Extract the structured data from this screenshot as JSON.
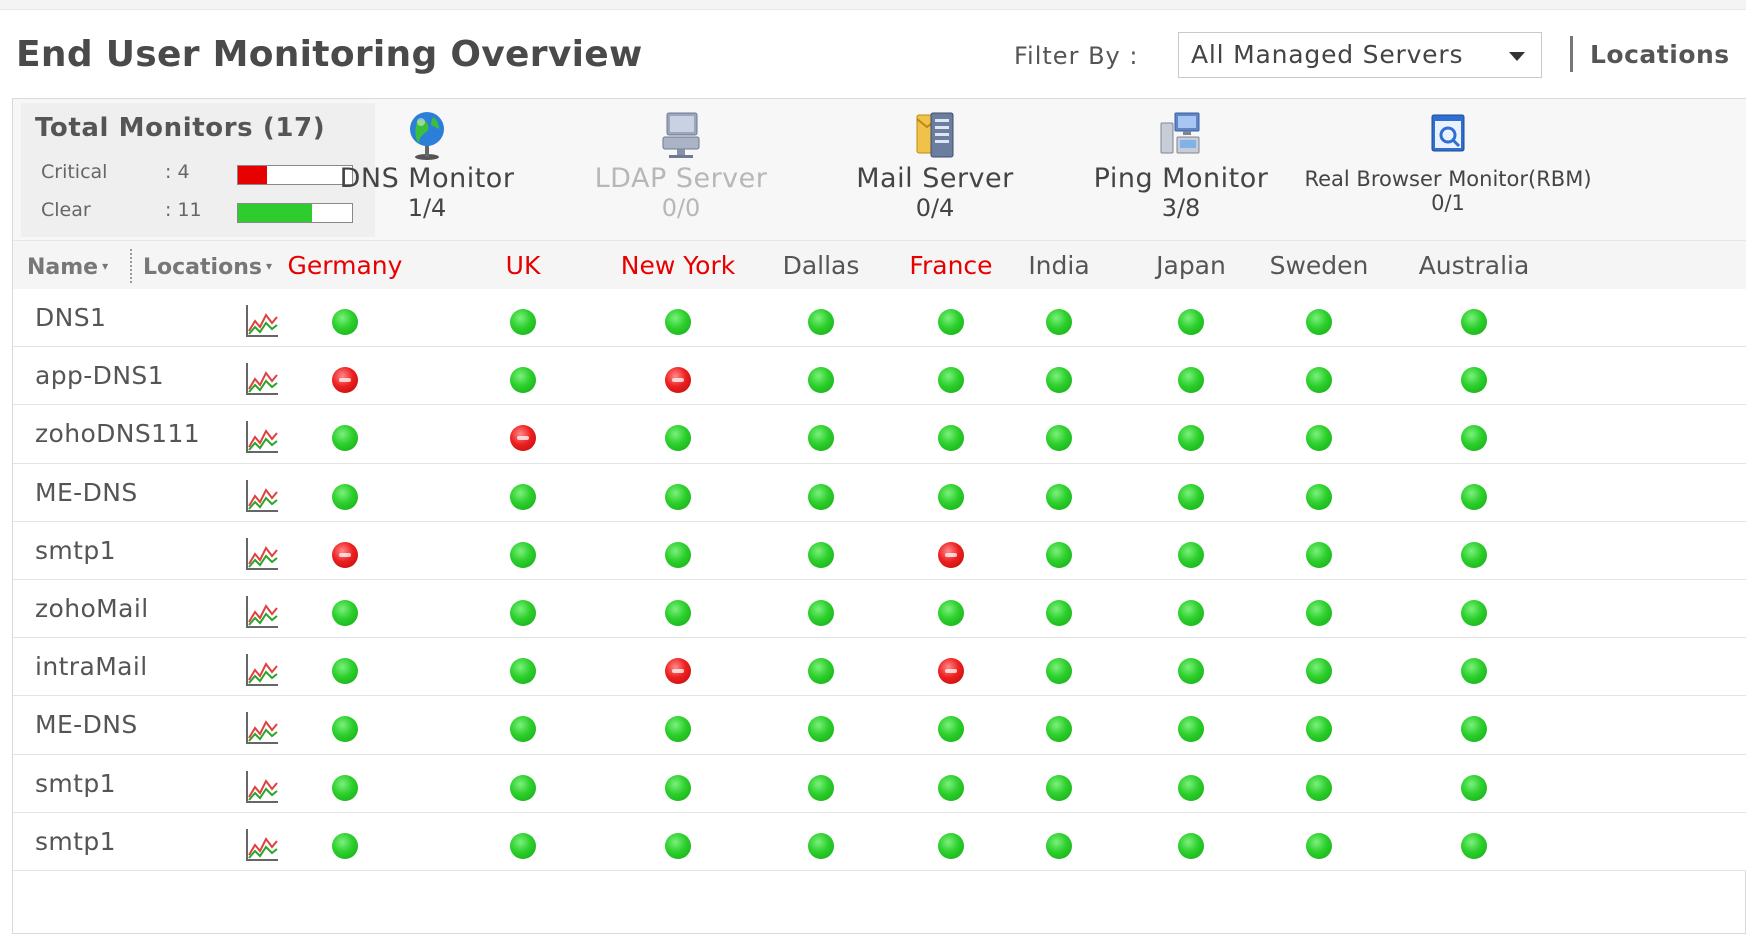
{
  "page": {
    "title": "End User Monitoring Overview",
    "filter_label": "Filter By :",
    "filter_value": "All Managed Servers",
    "locations_link": "Locations"
  },
  "summary": {
    "total_label": "Total Monitors (17)",
    "critical_label": "Critical",
    "critical_value": ": 4",
    "critical_fraction": 0.25,
    "clear_label": "Clear",
    "clear_value": ": 11",
    "clear_fraction": 0.65,
    "colors": {
      "critical": "#e60000",
      "clear": "#2ecc2e",
      "alert_text": "#e60000"
    }
  },
  "monitor_types": [
    {
      "name": "DNS Monitor",
      "count": "1/4",
      "icon": "globe-icon",
      "disabled": false
    },
    {
      "name": "LDAP Server",
      "count": "0/0",
      "icon": "server-directory-icon",
      "disabled": true
    },
    {
      "name": "Mail Server",
      "count": "0/4",
      "icon": "mail-server-icon",
      "disabled": false
    },
    {
      "name": "Ping Monitor",
      "count": "3/8",
      "icon": "network-computers-icon",
      "disabled": false
    },
    {
      "name": "Real Browser Monitor(RBM)",
      "count": "0/1",
      "icon": "browser-window-icon",
      "disabled": false
    }
  ],
  "table": {
    "name_header": "Name",
    "locations_header": "Locations",
    "locations": [
      {
        "name": "Germany",
        "alert": true
      },
      {
        "name": "UK",
        "alert": true
      },
      {
        "name": "New York",
        "alert": true
      },
      {
        "name": "Dallas",
        "alert": false
      },
      {
        "name": "France",
        "alert": true
      },
      {
        "name": "India",
        "alert": false
      },
      {
        "name": "Japan",
        "alert": false
      },
      {
        "name": "Sweden",
        "alert": false
      },
      {
        "name": "Australia",
        "alert": false
      }
    ],
    "rows": [
      {
        "name": "DNS1",
        "status": [
          "up",
          "up",
          "up",
          "up",
          "up",
          "up",
          "up",
          "up",
          "up"
        ]
      },
      {
        "name": "app-DNS1",
        "status": [
          "down",
          "up",
          "down",
          "up",
          "up",
          "up",
          "up",
          "up",
          "up"
        ]
      },
      {
        "name": "zohoDNS111",
        "status": [
          "up",
          "down",
          "up",
          "up",
          "up",
          "up",
          "up",
          "up",
          "up"
        ]
      },
      {
        "name": "ME-DNS",
        "status": [
          "up",
          "up",
          "up",
          "up",
          "up",
          "up",
          "up",
          "up",
          "up"
        ]
      },
      {
        "name": "smtp1",
        "status": [
          "down",
          "up",
          "up",
          "up",
          "down",
          "up",
          "up",
          "up",
          "up"
        ]
      },
      {
        "name": "zohoMail",
        "status": [
          "up",
          "up",
          "up",
          "up",
          "up",
          "up",
          "up",
          "up",
          "up"
        ]
      },
      {
        "name": "intraMail",
        "status": [
          "up",
          "up",
          "down",
          "up",
          "down",
          "up",
          "up",
          "up",
          "up"
        ]
      },
      {
        "name": "ME-DNS",
        "status": [
          "up",
          "up",
          "up",
          "up",
          "up",
          "up",
          "up",
          "up",
          "up"
        ]
      },
      {
        "name": "smtp1",
        "status": [
          "up",
          "up",
          "up",
          "up",
          "up",
          "up",
          "up",
          "up",
          "up"
        ]
      },
      {
        "name": "smtp1",
        "status": [
          "up",
          "up",
          "up",
          "up",
          "up",
          "up",
          "up",
          "up",
          "up"
        ]
      }
    ]
  }
}
